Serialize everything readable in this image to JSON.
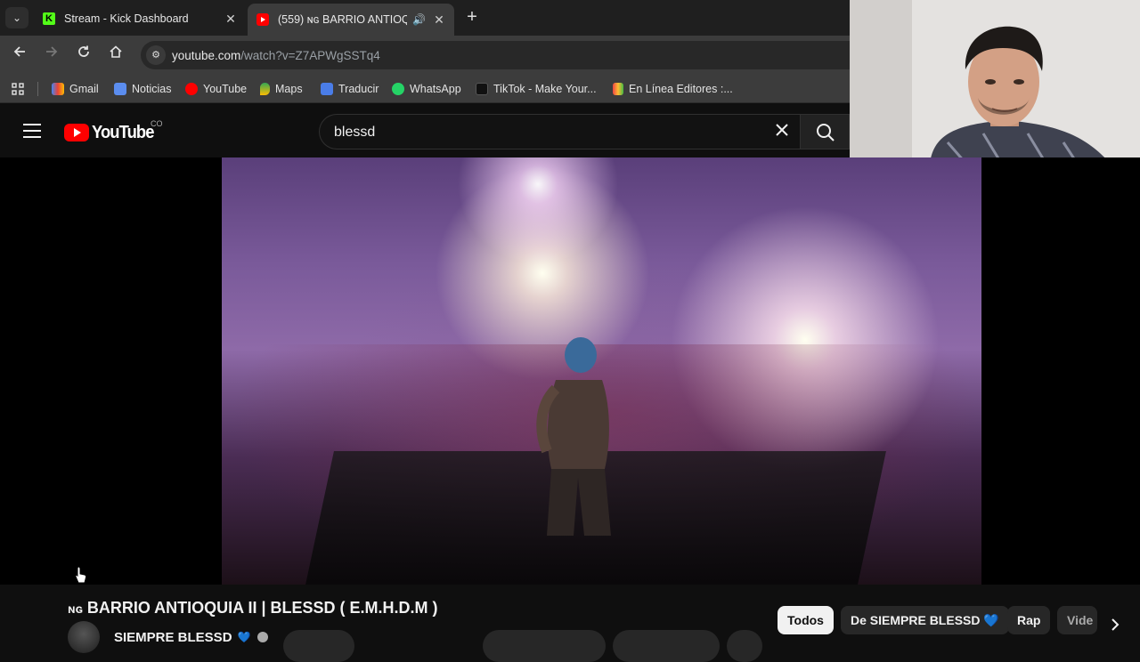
{
  "browser": {
    "tabs": [
      {
        "title": "Stream - Kick Dashboard",
        "active": false
      },
      {
        "title": "(559) ɴɢ BARRIO ANTIOQUIA",
        "active": true
      }
    ],
    "address": {
      "host": "youtube.com",
      "path": "/watch?v=Z7APWgSSTq4"
    },
    "bookmarks": [
      "Gmail",
      "Noticias",
      "YouTube",
      "Maps",
      "Traducir",
      "WhatsApp",
      "TikTok - Make Your...",
      "En Línea Editores :..."
    ]
  },
  "youtube": {
    "logo_text": "YouTube",
    "country_code": "CO",
    "search_query": "blessd",
    "video_title_prefix": "ɴɢ",
    "video_title": "BARRIO ANTIOQUIA II | BLESSD ( E.M.H.D.M )",
    "channel_name": "SIEMPRE BLESSD",
    "channel_heart": "💙",
    "chips": [
      "Todos",
      "De SIEMPRE BLESSD 💙",
      "Rap",
      "Vide"
    ]
  },
  "colors": {
    "accent": "#ff0000",
    "chip_active_bg": "#f1f1f1",
    "chrome_bg": "#3c3c3c"
  }
}
